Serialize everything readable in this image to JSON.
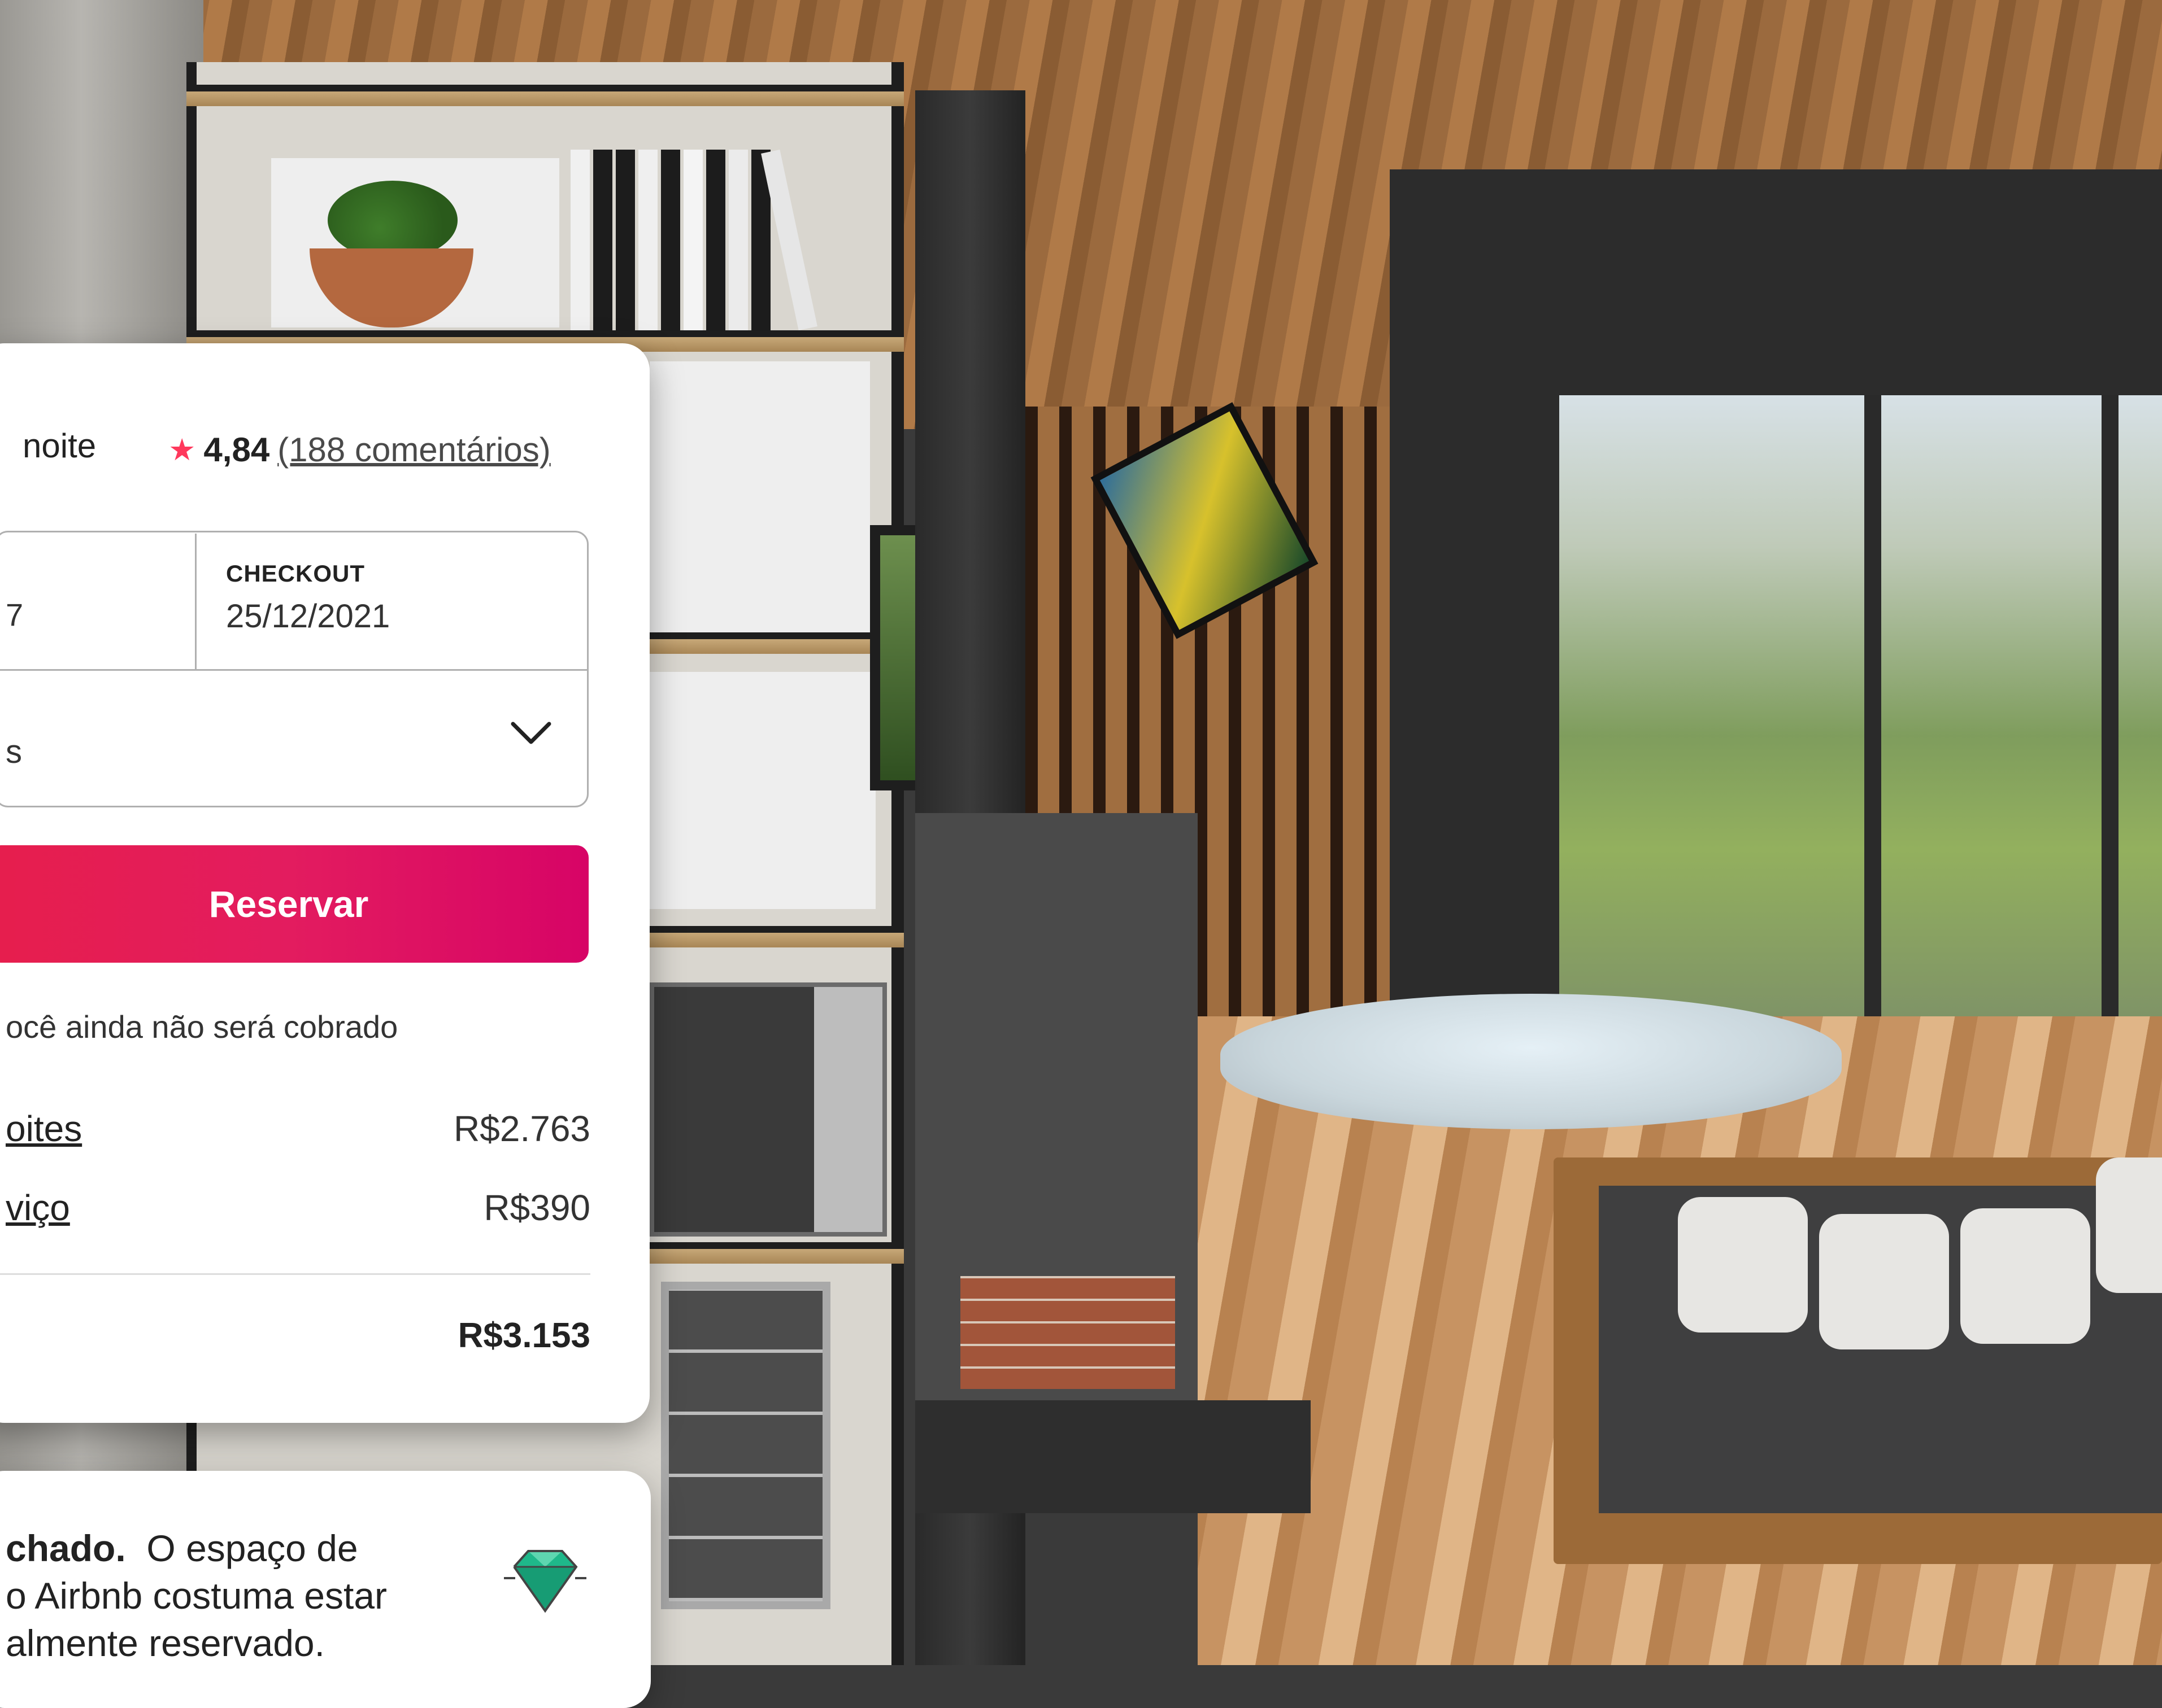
{
  "booking": {
    "price_per_night_suffix": "noite",
    "rating": {
      "value": "4,84",
      "reviews_link": "(188 comentários)"
    },
    "checkin": {
      "value_fragment": "7"
    },
    "checkout": {
      "label": "CHECKOUT",
      "value": "25/12/2021"
    },
    "guests": {
      "value_fragment": "s"
    },
    "reserve_button": "Reservar",
    "no_charge_note": "ocê ainda não será cobrado",
    "line_items": [
      {
        "label": "oites",
        "value": "R$2.763"
      },
      {
        "label": "viço",
        "value": "R$390"
      }
    ],
    "total": {
      "value": "R$3.153"
    }
  },
  "rare_find": {
    "bold_text": "chado.",
    "text_line1": "O espaço de",
    "text_line2": "o Airbnb costuma estar",
    "text_line3": "almente reservado."
  },
  "colors": {
    "brand_pink": "#e31c5f",
    "star": "#ff385c",
    "diamond": "#1fb88a"
  },
  "icons": [
    "star-icon",
    "chevron-down-icon",
    "diamond-icon"
  ]
}
